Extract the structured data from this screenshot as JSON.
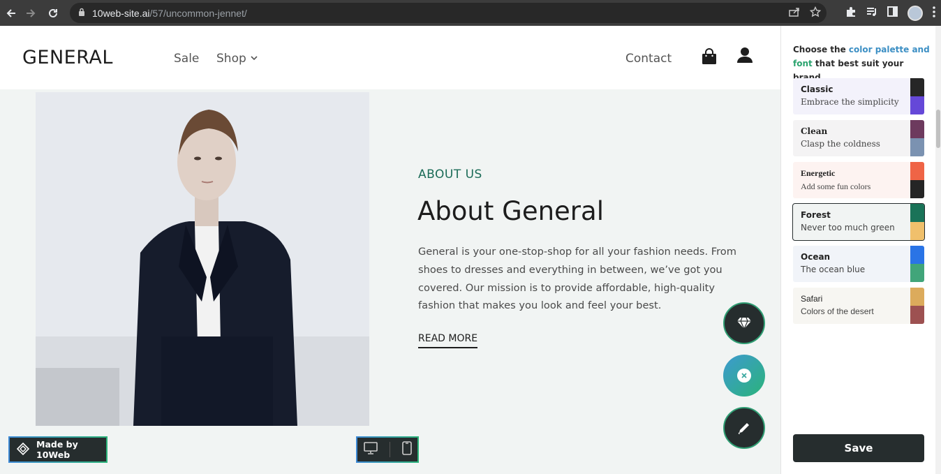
{
  "browser": {
    "url_host": "10web-site.ai",
    "url_path": "/57/uncommon-jennet/"
  },
  "site": {
    "logo": "GENERAL",
    "nav": {
      "sale": "Sale",
      "shop": "Shop",
      "contact": "Contact"
    }
  },
  "about": {
    "eyebrow": "ABOUT US",
    "title": "About General",
    "body": "General is your one-stop-shop for all your fashion needs. From shoes to dresses and everything in between, we’ve got you covered. Our mission is to provide affordable, high-quality fashion that makes you look and feel your best.",
    "read_more": "READ MORE"
  },
  "footer_bar": {
    "made_by": "Made by 10Web"
  },
  "panel": {
    "intro_pre": "Choose the ",
    "intro_hl1": "color palette and",
    "intro_hl2": "font",
    "intro_post": " that best suit your brand.",
    "palettes": [
      {
        "name": "Classic",
        "desc": "Embrace the simplicity",
        "bg": "#f3f2fb",
        "c1": "#262626",
        "c2": "#6548d8"
      },
      {
        "name": "Clean",
        "desc": "Clasp the coldness",
        "bg": "#f4f3f4",
        "c1": "#6d3a5e",
        "c2": "#7b92b1"
      },
      {
        "name": "Energetic",
        "desc": "Add some fun colors",
        "bg": "#fdf3f1",
        "c1": "#ef6446",
        "c2": "#252525"
      },
      {
        "name": "Forest",
        "desc": "Never too much green",
        "bg": "#f1f4f3",
        "c1": "#1a7358",
        "c2": "#f0c06c"
      },
      {
        "name": "Ocean",
        "desc": "The ocean blue",
        "bg": "#f1f4f9",
        "c1": "#2a74e6",
        "c2": "#41a57a"
      },
      {
        "name": "Safari",
        "desc": "Colors of the desert",
        "bg": "#f7f6f2",
        "c1": "#dcab5c",
        "c2": "#9d5151"
      }
    ],
    "save": "Save"
  }
}
